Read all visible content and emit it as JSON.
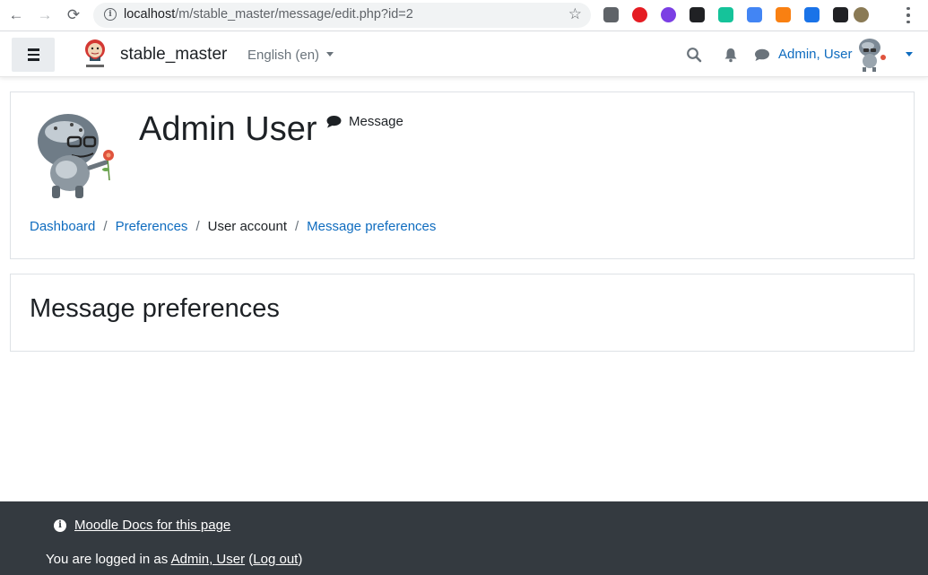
{
  "browser": {
    "url_host": "localhost",
    "url_path": "/m/stable_master/message/edit.php?id=2",
    "extensions": [
      {
        "name": "eyedropper-icon",
        "color": "#5f6368"
      },
      {
        "name": "adblock-icon",
        "color": "#e51c23"
      },
      {
        "name": "color-wheel-icon",
        "color": "#7b3fe4"
      },
      {
        "name": "gnome-icon",
        "color": "#202124"
      },
      {
        "name": "grammarly-off-icon",
        "color": "#15c39a"
      },
      {
        "name": "google-translate-icon",
        "color": "#4285f4"
      },
      {
        "name": "moodle-icon",
        "color": "#f98012"
      },
      {
        "name": "reader-icon",
        "color": "#1a73e8"
      },
      {
        "name": "extension-dark-icon",
        "color": "#202124"
      },
      {
        "name": "profile-avatar-icon",
        "color": "#8a7a55"
      }
    ]
  },
  "navbar": {
    "site_name": "stable_master",
    "language": "English ‎(en)‎",
    "user_name": "Admin, User"
  },
  "header": {
    "title": "Admin User",
    "message_label": "Message",
    "breadcrumb": [
      {
        "label": "Dashboard",
        "link": true
      },
      {
        "label": "Preferences",
        "link": true
      },
      {
        "label": "User account",
        "link": false
      },
      {
        "label": "Message preferences",
        "link": true
      }
    ]
  },
  "main": {
    "title": "Message preferences"
  },
  "footer": {
    "docs_label": "Moodle Docs for this page",
    "logged_in_prefix": "You are logged in as",
    "user_link": "Admin, User",
    "logout_label": "Log out"
  },
  "colors": {
    "link": "#0f6cbf",
    "footer_bg": "#343a40",
    "text": "#1d2125"
  }
}
